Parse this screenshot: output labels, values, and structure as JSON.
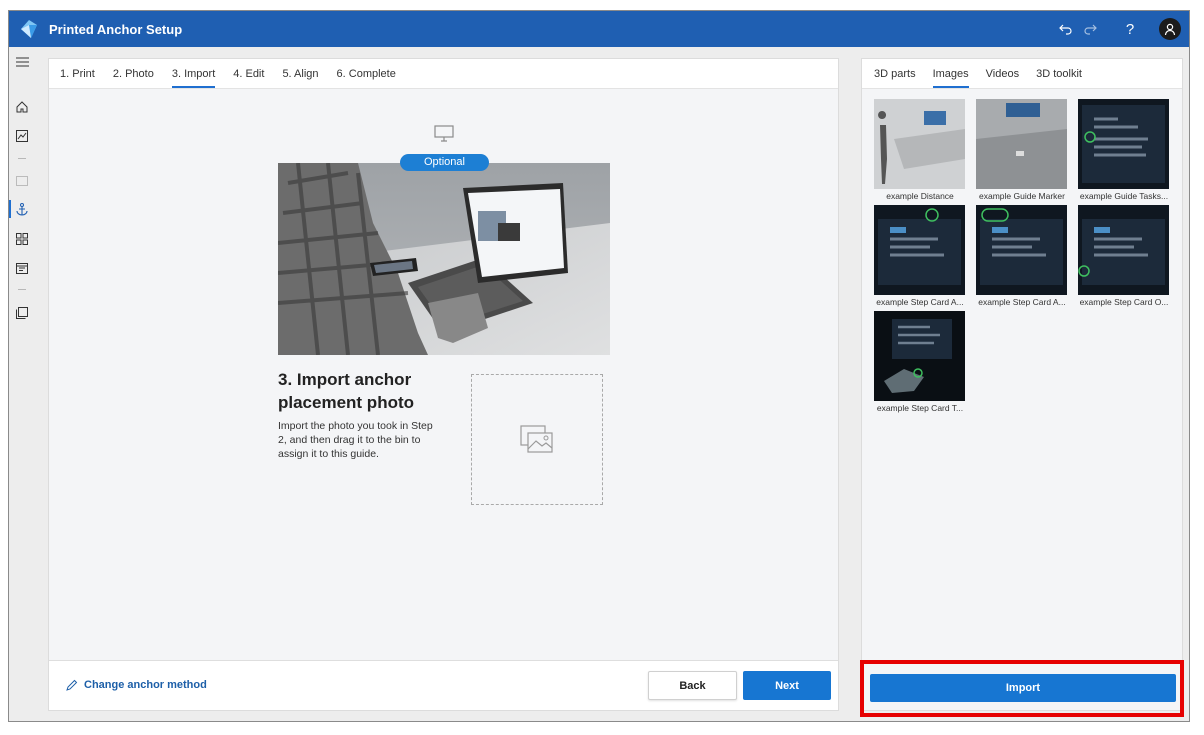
{
  "app": {
    "title": "Printed Anchor Setup",
    "brand_color": "#1f5fb2",
    "accent_color": "#1776d2",
    "title_actions": [
      "undo-icon",
      "redo-icon",
      "help-icon",
      "account-icon"
    ],
    "help_label": "?"
  },
  "left_rail": {
    "items": [
      "hamburger-icon",
      "home-icon",
      "analytics-icon",
      "card-icon",
      "anchor-icon",
      "grid-icon",
      "layout-icon",
      "library-icon"
    ],
    "active": "anchor-icon"
  },
  "steps": [
    {
      "label": "1. Print"
    },
    {
      "label": "2. Photo"
    },
    {
      "label": "3. Import",
      "active": true
    },
    {
      "label": "4. Edit"
    },
    {
      "label": "5. Align"
    },
    {
      "label": "6. Complete"
    }
  ],
  "content": {
    "optional_badge": "Optional",
    "heading": "3. Import anchor placement photo",
    "description": "Import the photo you took in Step 2, and then drag it to the bin to assign it to this guide."
  },
  "footer": {
    "change_anchor_label": "Change anchor method",
    "back_label": "Back",
    "next_label": "Next"
  },
  "side_panel": {
    "tabs": [
      {
        "label": "3D parts"
      },
      {
        "label": "Images",
        "active": true
      },
      {
        "label": "Videos"
      },
      {
        "label": "3D toolkit"
      }
    ],
    "images": [
      {
        "caption": "example Distance"
      },
      {
        "caption": "example Guide Marker"
      },
      {
        "caption": "example Guide Tasks..."
      },
      {
        "caption": "example Step Card A..."
      },
      {
        "caption": "example Step Card A..."
      },
      {
        "caption": "example Step Card O..."
      },
      {
        "caption": "example Step Card T..."
      }
    ],
    "import_label": "Import"
  }
}
